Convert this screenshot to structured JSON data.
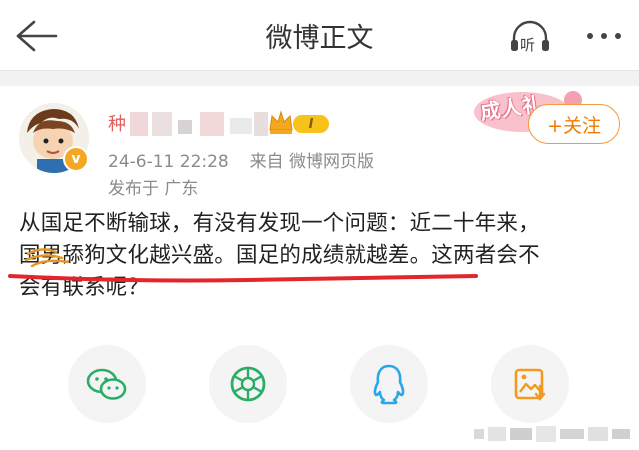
{
  "nav": {
    "title": "微博正文",
    "back_icon": "back-arrow-icon",
    "listen_label": "听",
    "more_icon": "more-dots-icon"
  },
  "author": {
    "name_partial": "种",
    "level": "I",
    "post_time": "24-6-11 22:28",
    "source": "来自 微博网页版",
    "location": "发布于 广东",
    "follow_label": "+关注",
    "sticker_text": "成人礼"
  },
  "post": {
    "lines": [
      "从国足不断输球，有没有发现一个问题：近二十年来，",
      "国男舔狗文化越兴盛。国足的成绩就越差。这两者会不",
      "会有联系呢？"
    ]
  },
  "share": {
    "items": [
      {
        "icon": "wechat-icon"
      },
      {
        "icon": "moments-icon"
      },
      {
        "icon": "qq-icon"
      },
      {
        "icon": "save-image-icon"
      }
    ]
  },
  "colors": {
    "accent_orange": "#f07b00",
    "underline_red": "#e3262b",
    "wechat_green": "#2aae67",
    "qq_blue": "#2aa7e8",
    "save_orange": "#f39a1e"
  }
}
